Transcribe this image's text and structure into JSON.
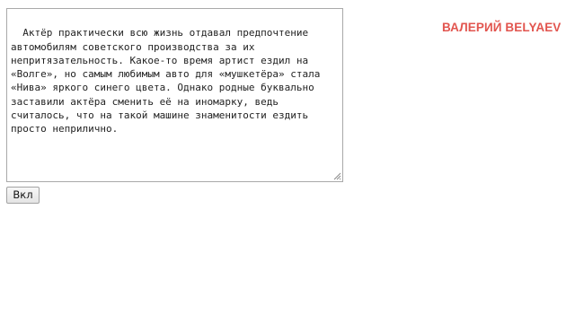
{
  "editor": {
    "text": "Актёр практически всю жизнь отдавал предпочтение\nавтомобилям советского производства за их\nнепритязательность. Какое-то время артист ездил на\n«Волге», но самым любимым авто для «мушкетёра» стала\n«Нива» яркого синего цвета. Однако родные буквально\nзаставили актёра сменить её на иномарку, ведь\nсчиталось, что на такой машине знаменитости ездить\nпросто неприлично."
  },
  "brand": {
    "label": "ВАЛЕРИЙ BELYAEV",
    "color": "#e2554f"
  },
  "submit_button": {
    "label": "Вкл"
  }
}
